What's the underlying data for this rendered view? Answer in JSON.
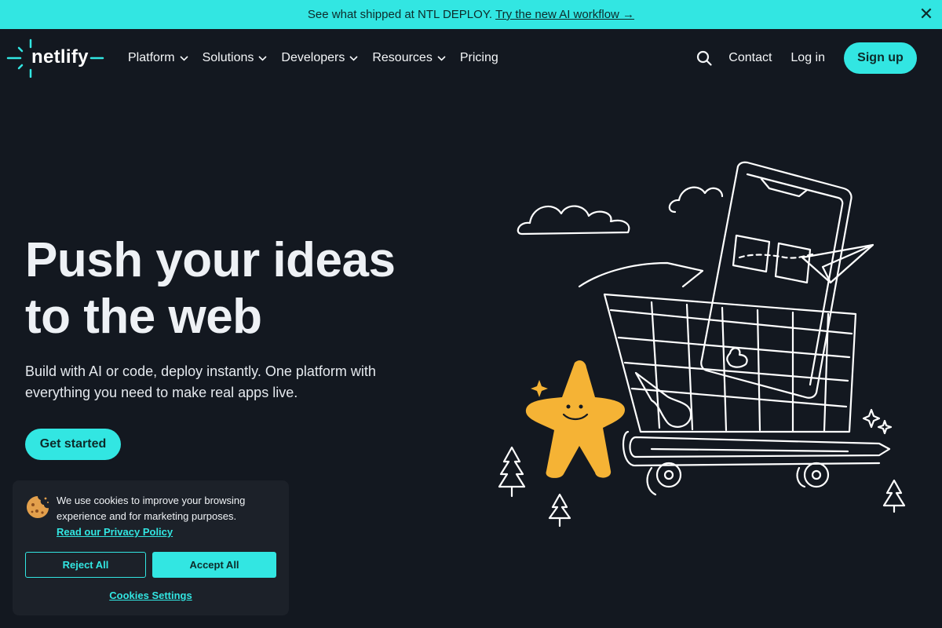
{
  "announcement": {
    "text": "See what shipped at NTL DEPLOY.",
    "link": "Try the new AI workflow →",
    "close": "✕"
  },
  "brand": {
    "logo_text": "netlify"
  },
  "nav": {
    "items": [
      {
        "label": "Platform"
      },
      {
        "label": "Solutions"
      },
      {
        "label": "Developers"
      },
      {
        "label": "Resources"
      },
      {
        "label": "Pricing"
      }
    ],
    "contact": "Contact",
    "login": "Log in",
    "signup": "Sign up"
  },
  "hero": {
    "title_line1": "Push your ideas",
    "title_line2": "to the web",
    "subtitle": "Build with AI or code, deploy instantly. One platform with everything you need to make real apps live.",
    "cta": "Get started"
  },
  "cookie": {
    "text": "We use cookies to improve your browsing experience and for marketing purposes.",
    "link": "Read our Privacy Policy",
    "reject": "Reject All",
    "accept": "Accept All",
    "settings": "Cookies Settings"
  },
  "colors": {
    "accent": "#32e6e2",
    "background": "#131820",
    "mascot": "#f5b335"
  }
}
